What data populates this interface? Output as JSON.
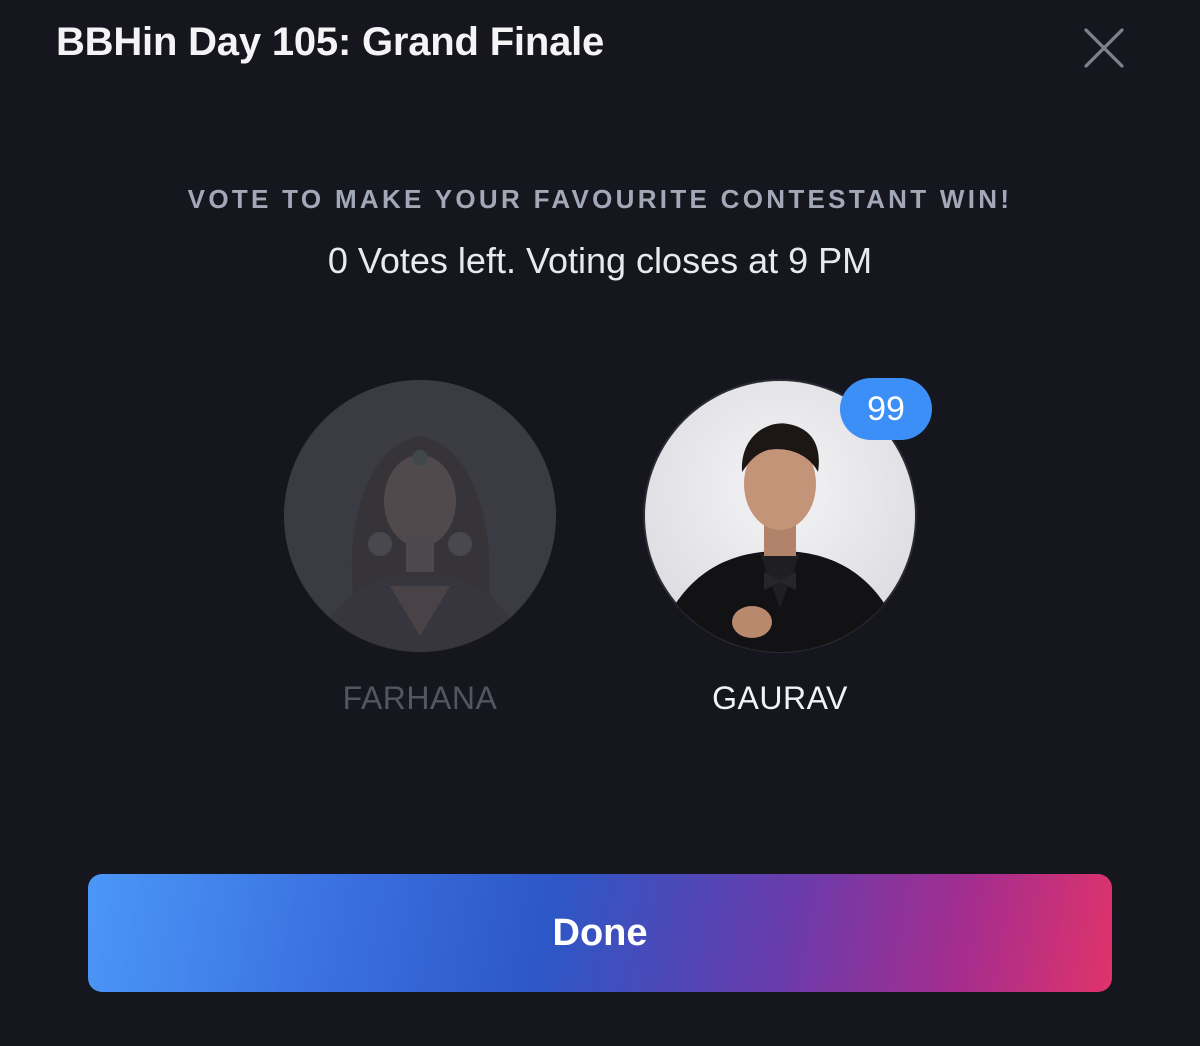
{
  "header": {
    "title": "BBHin Day 105: Grand Finale",
    "close_icon": "close-icon"
  },
  "poll": {
    "prompt": "VOTE TO MAKE YOUR FAVOURITE CONTESTANT WIN!",
    "votes_left": "0",
    "votes_text": "Votes left. Voting closes at 9 PM"
  },
  "contestants": [
    {
      "name": "FARHANA",
      "state": "dimmed"
    },
    {
      "name": "GAURAV",
      "state": "selected",
      "vote_count": "99"
    }
  ],
  "actions": {
    "done_label": "Done"
  },
  "colors": {
    "background": "#16171e",
    "badge": "#3b8ff6",
    "gradient_start": "#4b97f7",
    "gradient_end": "#e0336a"
  }
}
